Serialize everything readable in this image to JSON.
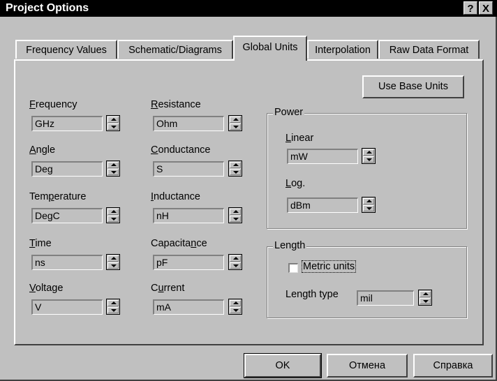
{
  "window": {
    "title": "Project Options",
    "help_label": "?",
    "close_label": "X"
  },
  "tabs": [
    {
      "label": "Frequency Values"
    },
    {
      "label": "Schematic/Diagrams"
    },
    {
      "label": "Global Units"
    },
    {
      "label": "Interpolation"
    },
    {
      "label": "Raw Data Format"
    }
  ],
  "use_base_units_label": "Use Base Units",
  "units": {
    "frequency": {
      "label_u": "F",
      "label_rest": "requency",
      "value": "GHz"
    },
    "angle": {
      "label_u": "A",
      "label_rest": "ngle",
      "value": "Deg"
    },
    "temperature": {
      "label_pre": "Tem",
      "label_u": "p",
      "label_rest": "erature",
      "value": "DegC"
    },
    "time": {
      "label_u": "T",
      "label_rest": "ime",
      "value": "ns"
    },
    "voltage": {
      "label_u": "V",
      "label_rest": "oltage",
      "value": "V"
    },
    "resistance": {
      "label_u": "R",
      "label_rest": "esistance",
      "value": "Ohm"
    },
    "conductance": {
      "label_u": "C",
      "label_rest": "onductance",
      "value": "S"
    },
    "inductance": {
      "label_u": "I",
      "label_rest": "nductance",
      "value": "nH"
    },
    "capacitance": {
      "label_pre": "Capacita",
      "label_u": "n",
      "label_rest": "ce",
      "value": "pF"
    },
    "current": {
      "label_pre": "C",
      "label_u": "u",
      "label_rest": "rrent",
      "value": "mA"
    }
  },
  "power": {
    "title": "Power",
    "linear": {
      "label_u": "L",
      "label_rest": "inear",
      "value": "mW"
    },
    "log": {
      "label_u": "L",
      "label_rest": "og.",
      "value": "dBm"
    }
  },
  "length": {
    "title": "Length",
    "metric_label": "Metric units",
    "metric_checked": false,
    "type_label": "Length type",
    "type_value": "mil"
  },
  "buttons": {
    "ok": "OK",
    "cancel": "Отмена",
    "help": "Справка"
  }
}
